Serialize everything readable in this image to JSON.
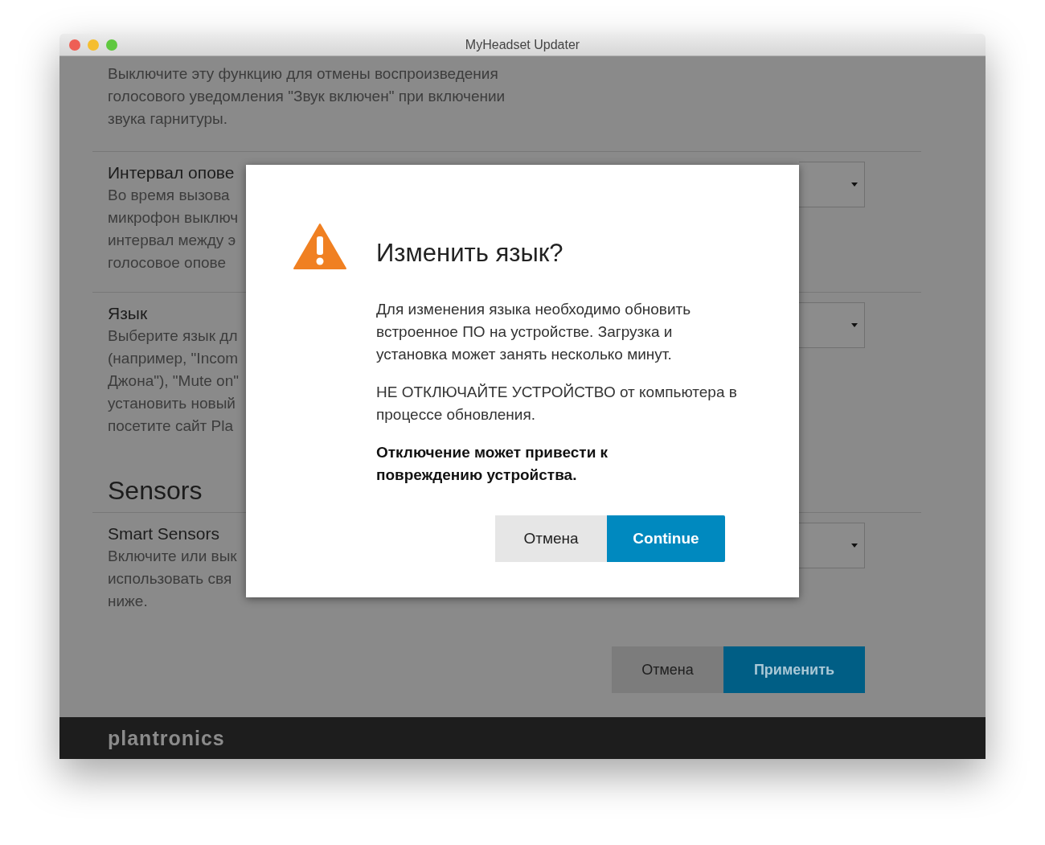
{
  "window": {
    "title": "MyHeadset Updater"
  },
  "intro": "Выключите эту функцию для отмены воспроизведения\nголосового уведомления \"Звук включен\" при включении\nзвука гарнитуры.",
  "settings": [
    {
      "title": "Интервал опове",
      "description": "Во время вызова\nмикрофон выключ\nинтервал между э\nголосовое опове"
    },
    {
      "title": "Язык",
      "description": "Выберите язык дл\n(например, \"Incom\nДжона\"), \"Mute on\"\nустановить новый\nпосетите сайт Pla"
    }
  ],
  "sensors": {
    "heading": "Sensors",
    "settings": [
      {
        "title": "Smart Sensors",
        "description": "Включите или вык\nиспользовать свя\nниже."
      }
    ]
  },
  "buttons": [
    {
      "label": "Отмена",
      "kind": "secondary"
    },
    {
      "label": "Применить",
      "kind": "primary"
    }
  ],
  "footer": {
    "logo": "plantronics"
  },
  "dialog": {
    "title": "Изменить язык?",
    "paragraphs": [
      {
        "text": "Для изменения языка необходимо обновить встроенное ПО на устройстве. Загрузка и установка может занять несколько минут.",
        "bold": false
      },
      {
        "text": "НЕ ОТКЛЮЧАЙТЕ УСТРОЙСТВО от компьютера в процессе обновления.",
        "bold": false
      },
      {
        "text": "Отключение может привести к повреждению устройства.",
        "bold": true
      }
    ],
    "buttons": [
      {
        "label": "Отмена",
        "kind": "secondary"
      },
      {
        "label": "Continue",
        "kind": "primary"
      }
    ]
  }
}
